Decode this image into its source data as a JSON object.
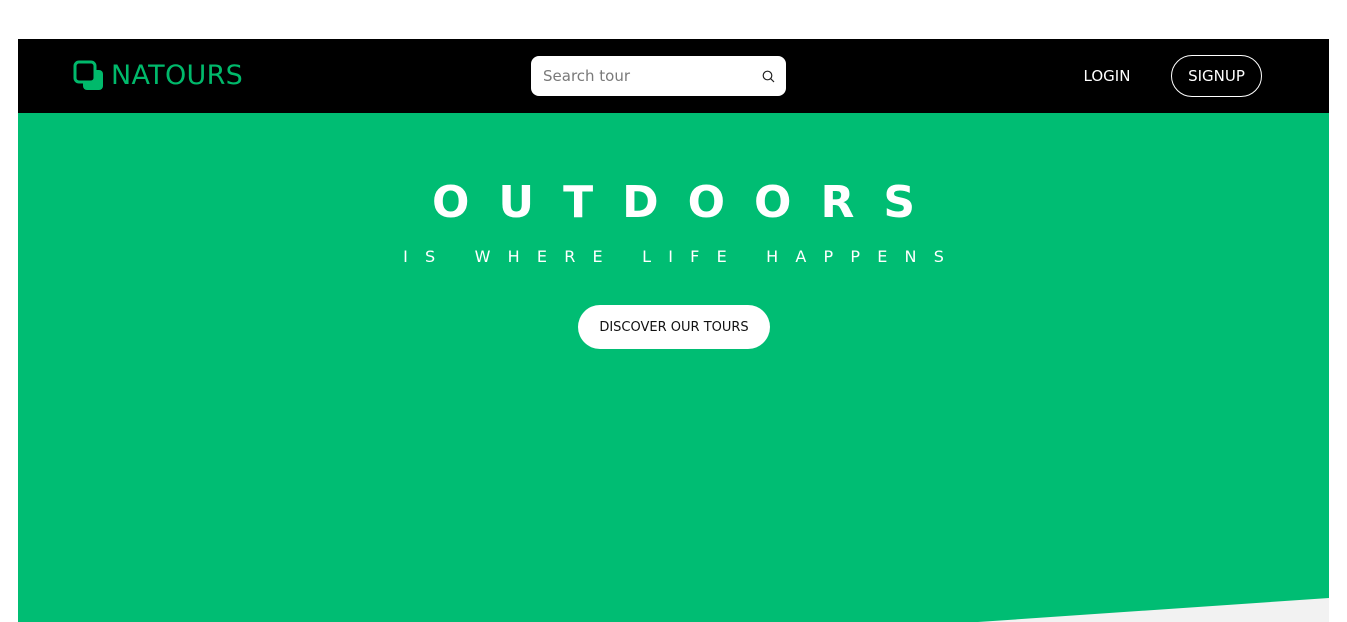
{
  "header": {
    "logo_text": "NATOURS",
    "logo_icon": "overlapping-squares-icon",
    "search": {
      "placeholder": "Search tour",
      "value": "",
      "icon": "search-icon"
    },
    "login_label": "LOGIN",
    "signup_label": "SIGNUP"
  },
  "hero": {
    "title": "OUTDOORS",
    "subtitle": "IS WHERE LIFE HAPPENS",
    "cta_label": "DISCOVER OUR TOURS"
  },
  "colors": {
    "brand_green": "#00b96b",
    "hero_green": "#00bd73",
    "nav_background": "#000000",
    "page_background": "#ffffff",
    "slant_gray": "#f2f2f2"
  }
}
